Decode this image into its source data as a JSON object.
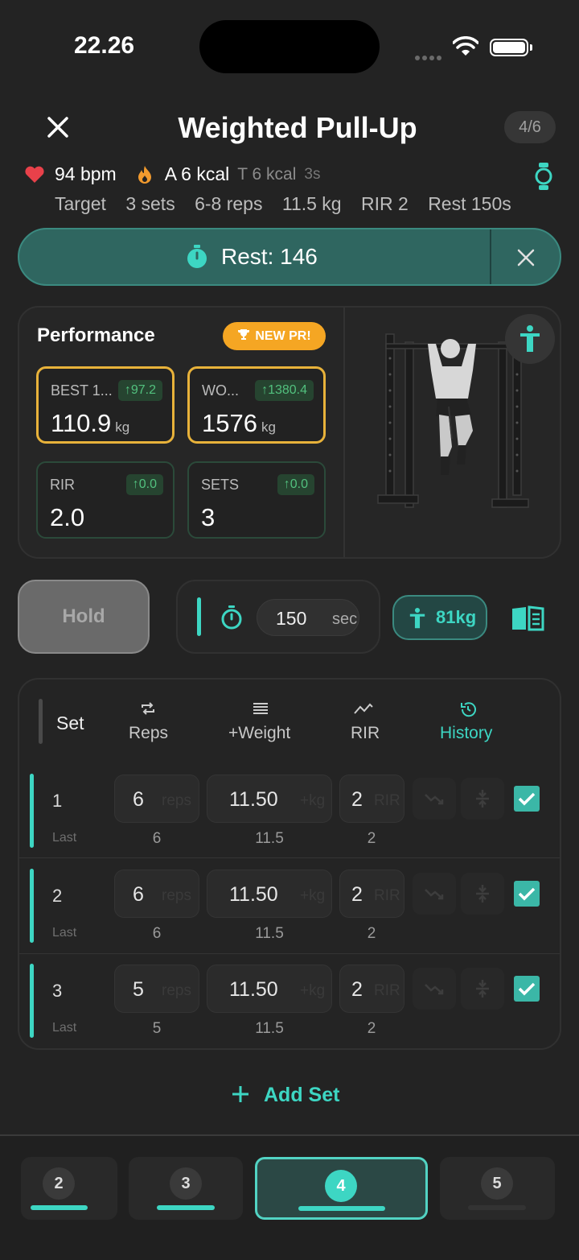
{
  "status": {
    "time": "22.26"
  },
  "header": {
    "title": "Weighted Pull-Up",
    "counter": "4/6"
  },
  "vitals": {
    "heart_rate": "94 bpm",
    "active_kcal": "A 6 kcal",
    "total_kcal": "T 6 kcal",
    "duration": "3s"
  },
  "target": {
    "label": "Target",
    "sets": "3 sets",
    "reps": "6-8 reps",
    "weight": "11.5 kg",
    "rir": "RIR 2",
    "rest": "Rest 150s"
  },
  "rest_timer": {
    "label": "Rest: 146"
  },
  "performance": {
    "title": "Performance",
    "badge": "NEW PR!",
    "stats": [
      {
        "label": "BEST 1...",
        "delta": "↑97.2",
        "value": "110.9",
        "unit": "kg"
      },
      {
        "label": "WO...",
        "delta": "↑1380.4",
        "value": "1576",
        "unit": "kg"
      },
      {
        "label": "RIR",
        "delta": "↑0.0",
        "value": "2.0",
        "unit": ""
      },
      {
        "label": "SETS",
        "delta": "↑0.0",
        "value": "3",
        "unit": ""
      }
    ]
  },
  "controls": {
    "hold_label": "Hold",
    "rest_seconds": "150",
    "rest_unit": "sec",
    "bodyweight": "81kg"
  },
  "table": {
    "headers": {
      "set": "Set",
      "reps": "Reps",
      "weight": "+Weight",
      "rir": "RIR",
      "history": "History"
    },
    "last_label": "Last",
    "placeholders": {
      "reps": "reps",
      "weight": "+kg",
      "rir": "RIR"
    },
    "rows": [
      {
        "set": "1",
        "reps": "6",
        "weight": "11.50",
        "rir": "2",
        "last_reps": "6",
        "last_weight": "11.5",
        "last_rir": "2"
      },
      {
        "set": "2",
        "reps": "6",
        "weight": "11.50",
        "rir": "2",
        "last_reps": "6",
        "last_weight": "11.5",
        "last_rir": "2"
      },
      {
        "set": "3",
        "reps": "5",
        "weight": "11.50",
        "rir": "2",
        "last_reps": "5",
        "last_weight": "11.5",
        "last_rir": "2"
      }
    ]
  },
  "add_set": "Add Set",
  "exercise_tabs": [
    "2",
    "3",
    "4",
    "5"
  ],
  "colors": {
    "accent": "#3dd6c3",
    "rest_bg": "#2f6660",
    "gold": "#e8b23a",
    "pr_badge": "#f5a623",
    "positive": "#52c07e"
  }
}
